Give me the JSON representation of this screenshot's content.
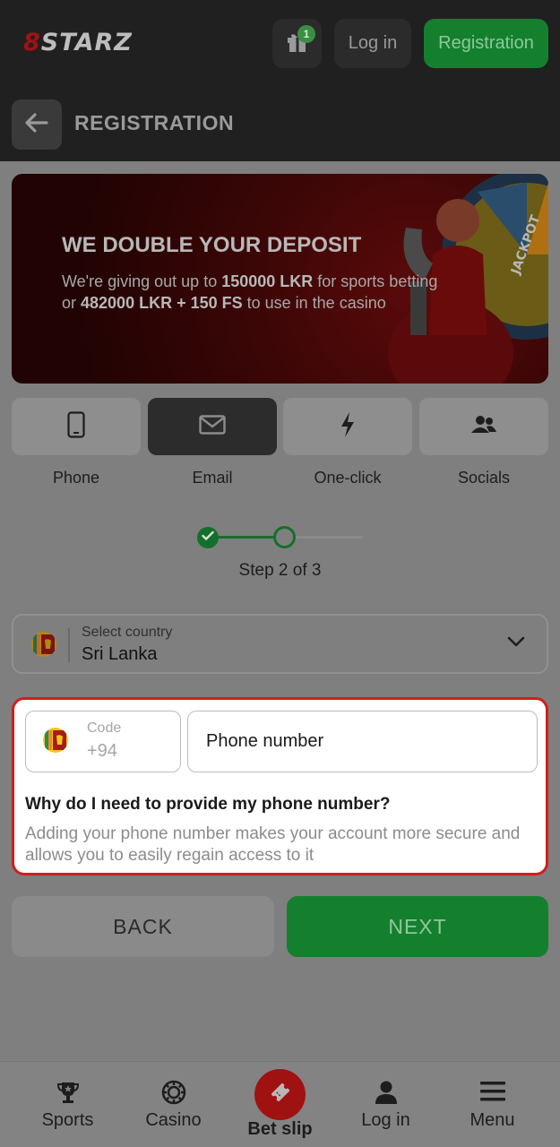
{
  "header": {
    "logo_prefix": "8",
    "logo_text": "STARZ",
    "gift_badge": "1",
    "login_label": "Log in",
    "registration_label": "Registration",
    "page_title": "REGISTRATION"
  },
  "banner": {
    "title": "WE DOUBLE YOUR DEPOSIT",
    "line1_pre": "We're giving out up to ",
    "line1_bold": "150000 LKR",
    "line1_post": " for sports betting",
    "line2_pre": "or ",
    "line2_bold": "482000 LKR + 150 FS",
    "line2_post": " to use in the casino",
    "wheel_text": "JACKPOT"
  },
  "tabs": [
    {
      "label": "Phone",
      "icon": "phone-icon",
      "active": false
    },
    {
      "label": "Email",
      "icon": "envelope-icon",
      "active": true
    },
    {
      "label": "One-click",
      "icon": "lightning-icon",
      "active": false
    },
    {
      "label": "Socials",
      "icon": "people-icon",
      "active": false
    }
  ],
  "stepper": {
    "text": "Step 2 of 3",
    "current": 2,
    "total": 3
  },
  "country": {
    "label": "Select country",
    "value": "Sri Lanka"
  },
  "phone": {
    "code_label": "Code",
    "code_value": "+94",
    "placeholder": "Phone number",
    "why_title": "Why do I need to provide my phone number?",
    "why_text": "Adding your phone number makes your account more secure and allows you to easily regain access to it"
  },
  "actions": {
    "back": "BACK",
    "next": "NEXT"
  },
  "bottom_nav": [
    {
      "label": "Sports",
      "icon": "trophy-icon"
    },
    {
      "label": "Casino",
      "icon": "casino-chip-icon"
    },
    {
      "label": "Bet slip",
      "icon": "ticket-icon"
    },
    {
      "label": "Log in",
      "icon": "user-icon"
    },
    {
      "label": "Menu",
      "icon": "menu-icon"
    }
  ],
  "colors": {
    "accent_green": "#14802e",
    "highlight_red": "#d31d1d",
    "brand_red": "#a01212"
  }
}
